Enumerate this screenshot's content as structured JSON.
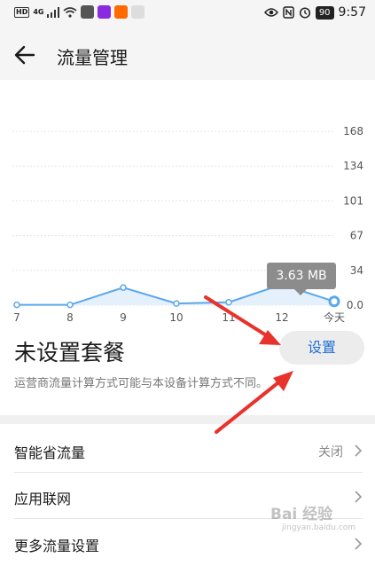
{
  "status_bar": {
    "left_indicators": [
      "HD",
      "4G"
    ],
    "battery": "90",
    "time": "9:57"
  },
  "header": {
    "title": "流量管理"
  },
  "chart_data": {
    "type": "line",
    "categories": [
      "7",
      "8",
      "9",
      "10",
      "11",
      "12",
      "今天"
    ],
    "values": [
      0.3,
      0.3,
      17,
      1.6,
      2.8,
      20,
      3.63
    ],
    "yticks": [
      "168",
      "134",
      "101",
      "67",
      "34",
      "0.0"
    ],
    "ylim": [
      0,
      168
    ],
    "grid": true,
    "highlighted_index": 6,
    "tooltip": "3.63 MB",
    "colors": {
      "line": "#5aa7ee",
      "area": "#e4f0fc"
    }
  },
  "plan": {
    "title": "未设置套餐",
    "button_label": "设置",
    "note": "运营商流量计算方式可能与本设备计算方式不同。"
  },
  "list": [
    {
      "label": "智能省流量",
      "value": "关闭"
    },
    {
      "label": "应用联网",
      "value": ""
    },
    {
      "label": "更多流量设置",
      "value": ""
    }
  ],
  "watermark": {
    "text": "Bai 经验",
    "subtext": "jingyan.baidu.com"
  },
  "colors": {
    "accent": "#1f6fd0",
    "annotation_arrow": "#e8322b"
  }
}
